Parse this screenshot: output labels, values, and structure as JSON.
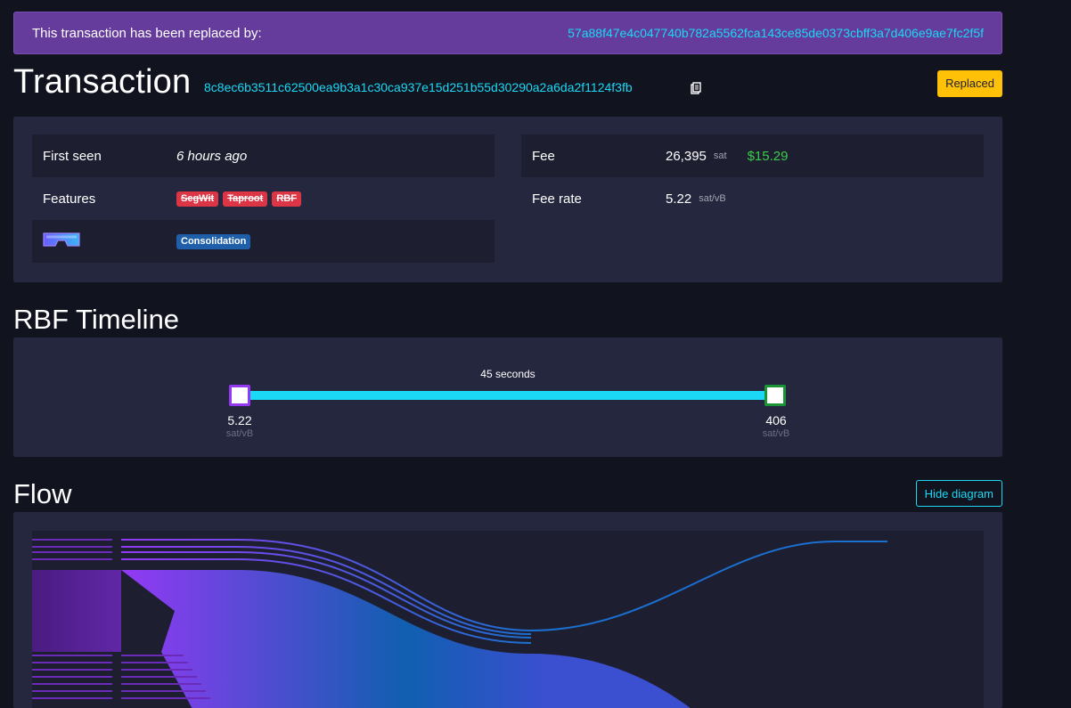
{
  "banner": {
    "label": "This transaction has been replaced by:",
    "replacement_txid": "57a88f47e4c047740b782a5562fca143ce85de0373cbff3a7d406e9ae7fc2f5f"
  },
  "header": {
    "title": "Transaction",
    "txid": "8c8ec6b3511c62500ea9b3a1c30ca937e15d251b55d30290a2a6da2f1124f3fb",
    "status_badge": "Replaced"
  },
  "details": {
    "first_seen_label": "First seen",
    "first_seen_value": "6 hours ago",
    "features_label": "Features",
    "features": [
      "SegWit",
      "Taproot",
      "RBF"
    ],
    "tag_label": "Consolidation",
    "fee_label": "Fee",
    "fee_value": "26,395",
    "fee_unit": "sat",
    "fee_usd": "$15.29",
    "fee_rate_label": "Fee rate",
    "fee_rate_value": "5.22",
    "fee_rate_unit": "sat/vB"
  },
  "rbf": {
    "title": "RBF Timeline",
    "elapsed": "45 seconds",
    "start_rate": "5.22",
    "end_rate": "406",
    "unit": "sat/vB"
  },
  "flow": {
    "title": "Flow",
    "hide_label": "Hide diagram"
  },
  "colors": {
    "accent": "#1bd8f4",
    "banner": "#653b9c",
    "badge": "#ffc107",
    "feature_tag": "#dc3545",
    "info_tag": "#1f5ea8",
    "usd": "#3bcc49"
  }
}
